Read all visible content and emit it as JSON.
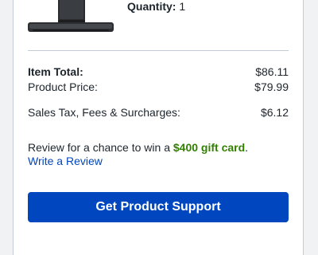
{
  "product": {
    "quantity_label": "Quantity:",
    "quantity_value": "1",
    "image_icon": "soundbar-product-image"
  },
  "summary": {
    "item_total_label": "Item Total:",
    "item_total_value": "$86.11",
    "product_price_label": "Product Price:",
    "product_price_value": "$79.99",
    "tax_label": "Sales Tax, Fees & Surcharges:",
    "tax_value": "$6.12"
  },
  "review": {
    "prompt_text": "Review for a chance to win a ",
    "gift_text": "$400 gift card",
    "prompt_end": ".",
    "link_label": "Write a Review"
  },
  "actions": {
    "support_button_label": "Get Product Support"
  },
  "colors": {
    "primary_blue": "#0046be",
    "gift_green": "#318000",
    "text": "#1d252c",
    "divider": "#c5cbd5"
  }
}
